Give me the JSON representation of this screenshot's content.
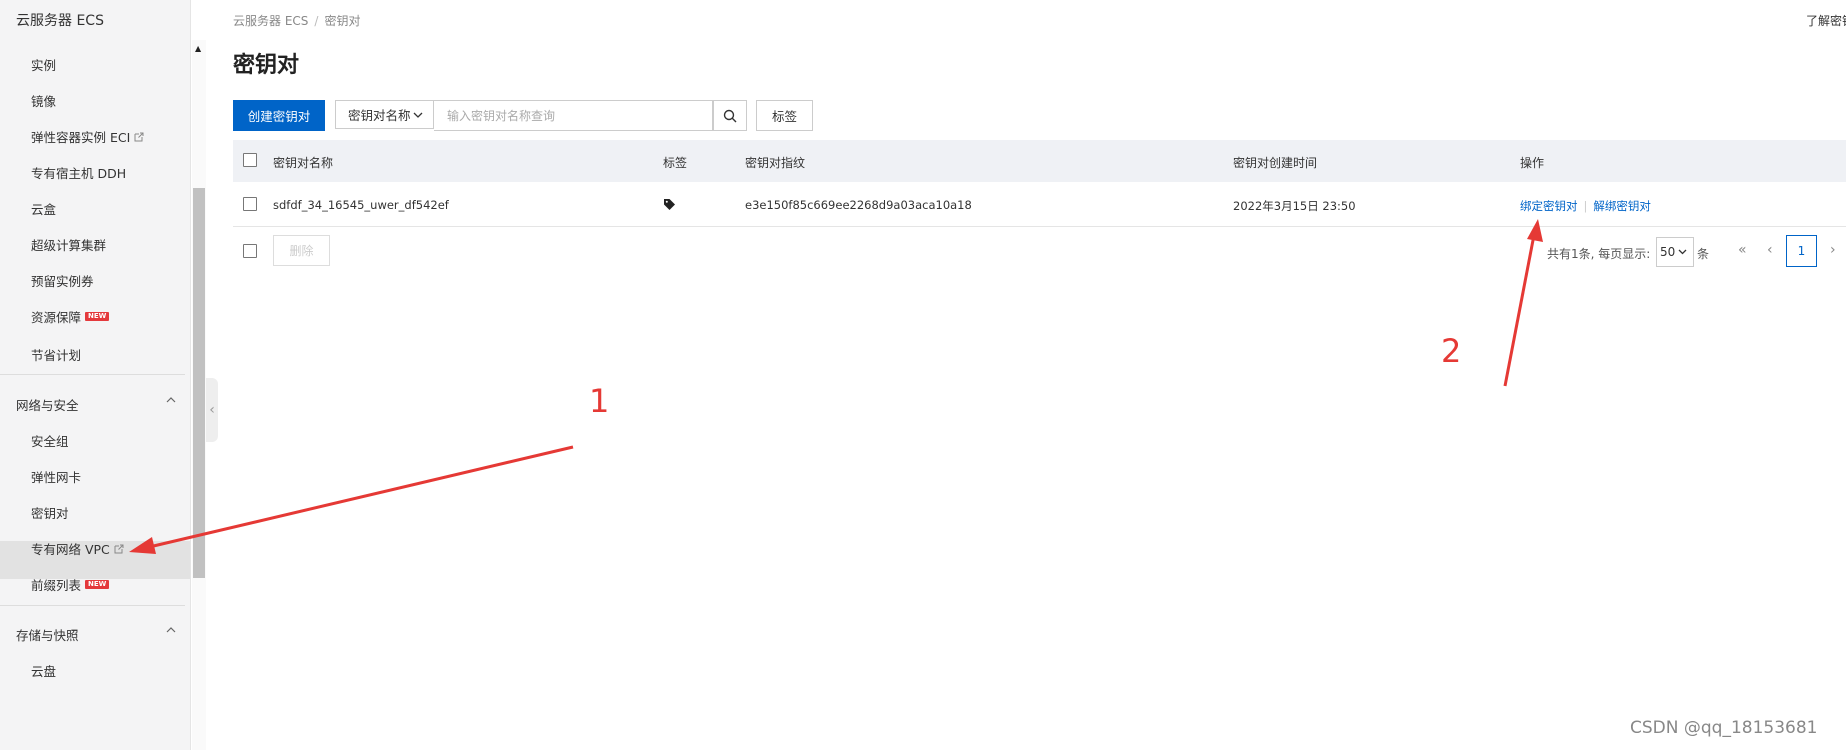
{
  "sidebar": {
    "title": "云服务器 ECS",
    "items": [
      {
        "label": "实例"
      },
      {
        "label": "镜像"
      },
      {
        "label": "弹性容器实例 ECI"
      },
      {
        "label": "专有宿主机 DDH"
      },
      {
        "label": "云盒"
      },
      {
        "label": "超级计算集群"
      },
      {
        "label": "预留实例券"
      },
      {
        "label": "资源保障"
      },
      {
        "label": "节省计划"
      }
    ],
    "network_group": {
      "label": "网络与安全",
      "items": [
        {
          "label": "安全组"
        },
        {
          "label": "弹性网卡"
        },
        {
          "label": "密钥对"
        },
        {
          "label": "专有网络 VPC"
        },
        {
          "label": "前缀列表"
        }
      ]
    },
    "storage_group": {
      "label": "存储与快照",
      "items": [
        {
          "label": "云盘"
        }
      ]
    },
    "new_badge": "NEW"
  },
  "breadcrumb": {
    "root": "云服务器 ECS",
    "separator": "/",
    "current": "密钥对"
  },
  "top_right_link": "了解密钥",
  "page_title": "密钥对",
  "toolbar": {
    "create_label": "创建密钥对",
    "filter_select": "密钥对名称",
    "search_placeholder": "输入密钥对名称查询",
    "tag_label": "标签"
  },
  "table": {
    "headers": {
      "name": "密钥对名称",
      "tag": "标签",
      "fingerprint": "密钥对指纹",
      "created": "密钥对创建时间",
      "actions": "操作"
    },
    "rows": [
      {
        "name": "sdfdf_34_16545_uwer_df542ef",
        "fingerprint": "e3e150f85c669ee2268d9a03aca10a18",
        "created": "2022年3月15日 23:50",
        "action_bind": "绑定密钥对",
        "action_unbind": "解绑密钥对"
      }
    ]
  },
  "footer": {
    "delete_label": "删除",
    "total_text": "共有1条, 每页显示:",
    "page_size": "50",
    "page_size_suffix": "条",
    "first": "«",
    "prev": "‹",
    "current_page": "1",
    "next": "›"
  },
  "annotations": {
    "one": "1",
    "two": "2"
  },
  "watermark": "CSDN @qq_18153681",
  "colors": {
    "primary": "#0064c8",
    "annotation": "#e53935",
    "new_badge": "#e4393c"
  }
}
